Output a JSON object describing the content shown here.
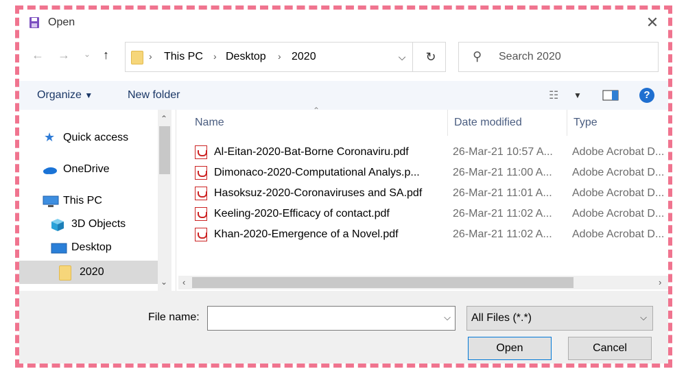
{
  "window": {
    "title": "Open"
  },
  "address": {
    "crumbs": [
      "This PC",
      "Desktop",
      "2020"
    ],
    "search_placeholder": "Search 2020"
  },
  "toolbar": {
    "organize": "Organize",
    "new_folder": "New folder"
  },
  "nav": {
    "items": [
      {
        "label": "Quick access",
        "icon": "star-icon"
      },
      {
        "label": "OneDrive",
        "icon": "cloud-icon"
      },
      {
        "label": "This PC",
        "icon": "computer-icon"
      },
      {
        "label": "3D Objects",
        "icon": "cube-icon"
      },
      {
        "label": "Desktop",
        "icon": "desktop-icon"
      },
      {
        "label": "2020",
        "icon": "folder-icon",
        "selected": true
      }
    ]
  },
  "files": {
    "columns": [
      "Name",
      "Date modified",
      "Type"
    ],
    "rows": [
      {
        "name": "Al-Eitan-2020-Bat-Borne Coronaviru.pdf",
        "date": "26-Mar-21 10:57 A...",
        "type": "Adobe Acrobat D..."
      },
      {
        "name": "Dimonaco-2020-Computational Analys.p...",
        "date": "26-Mar-21 11:00 A...",
        "type": "Adobe Acrobat D..."
      },
      {
        "name": "Hasoksuz-2020-Coronaviruses and SA.pdf",
        "date": "26-Mar-21 11:01 A...",
        "type": "Adobe Acrobat D..."
      },
      {
        "name": "Keeling-2020-Efficacy of contact.pdf",
        "date": "26-Mar-21 11:02 A...",
        "type": "Adobe Acrobat D..."
      },
      {
        "name": "Khan-2020-Emergence of a Novel.pdf",
        "date": "26-Mar-21 11:02 A...",
        "type": "Adobe Acrobat D..."
      }
    ]
  },
  "bottom": {
    "file_name_label": "File name:",
    "file_name_value": "",
    "file_type": "All Files (*.*)",
    "open": "Open",
    "cancel": "Cancel"
  },
  "colors": {
    "accent": "#0078d7",
    "frame": "#f0748f",
    "selected": "#d9d9d9"
  }
}
